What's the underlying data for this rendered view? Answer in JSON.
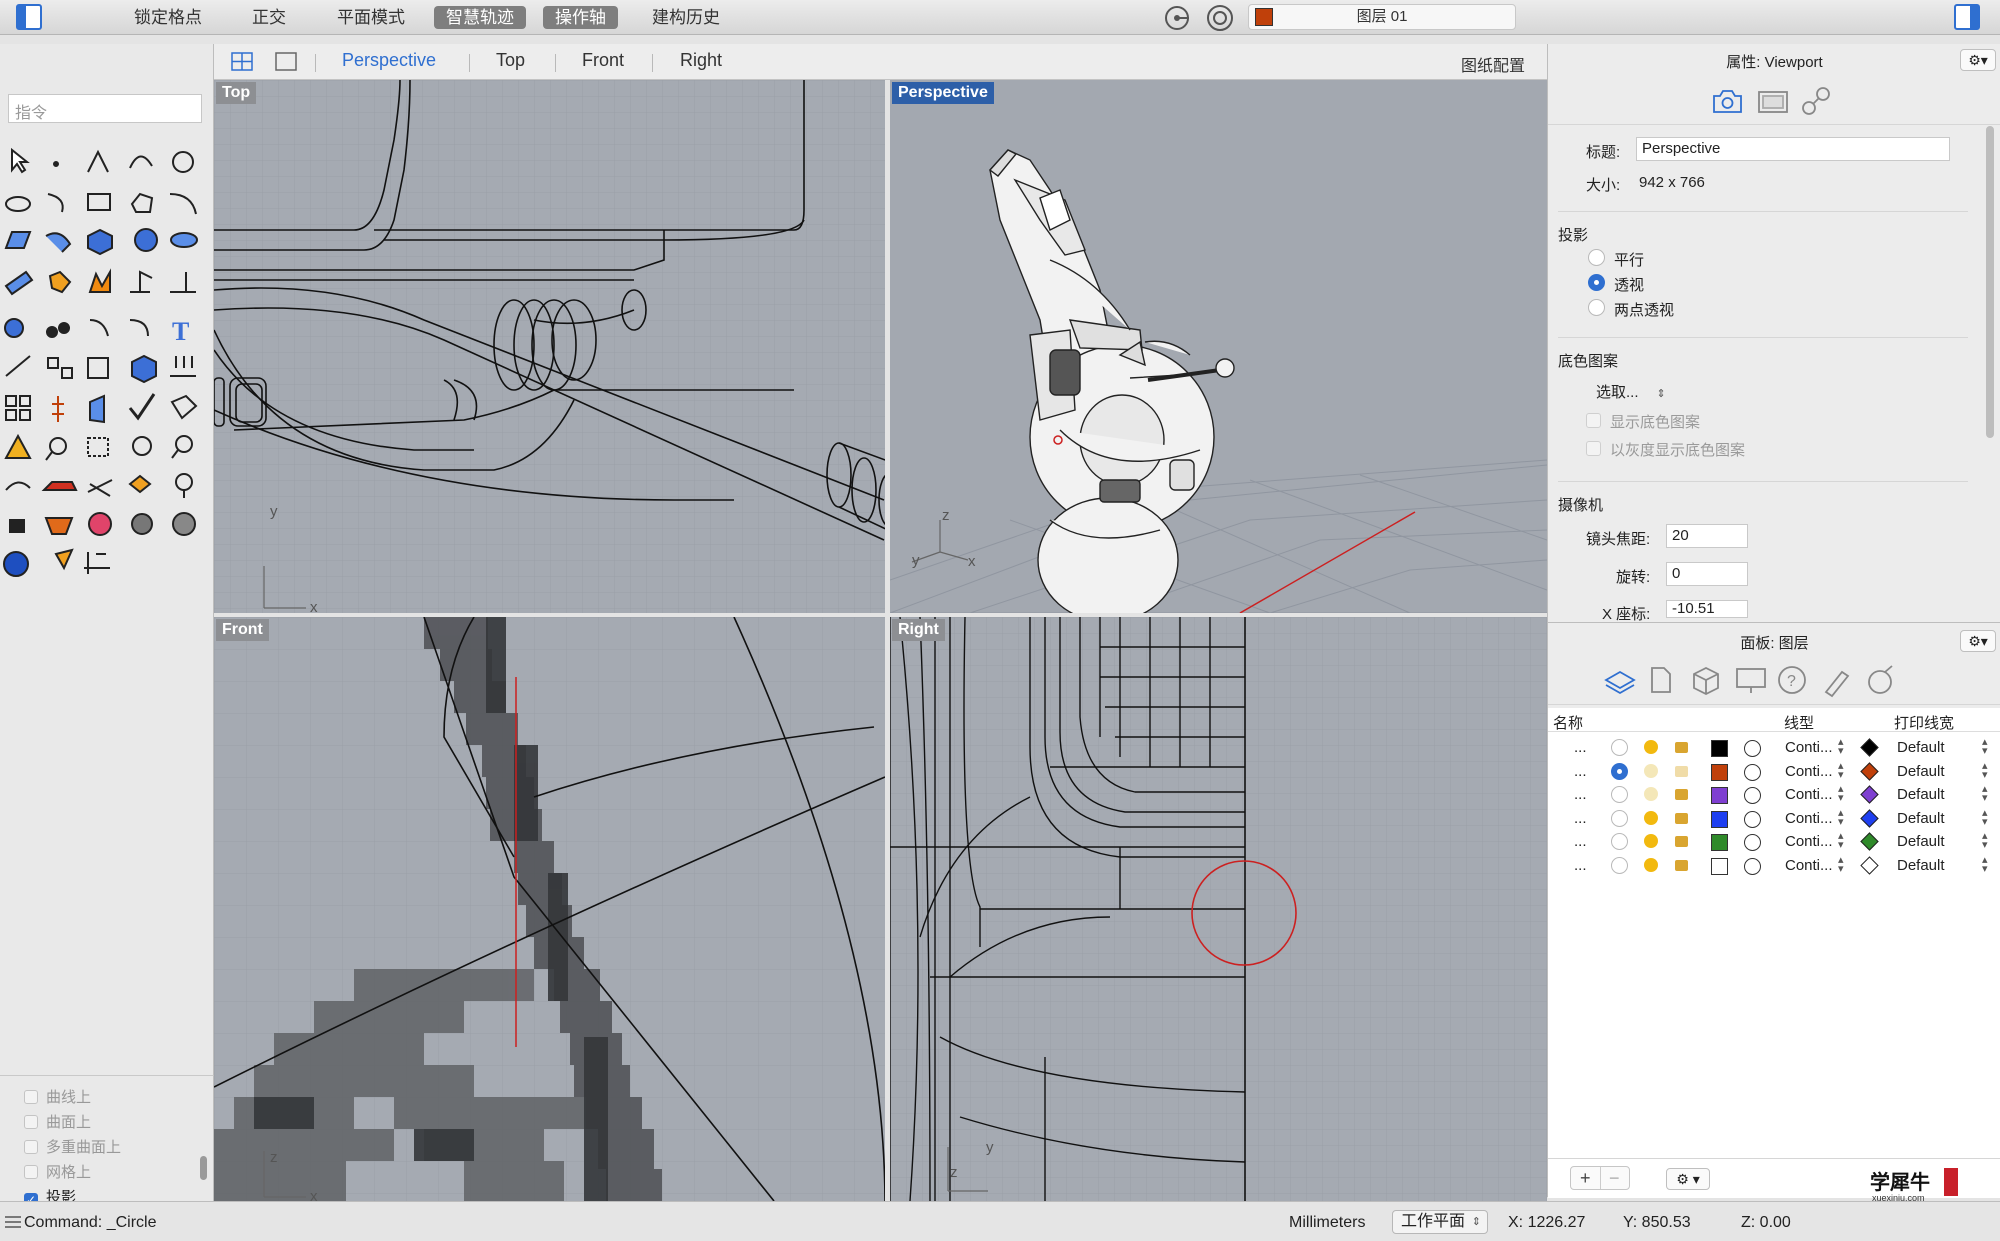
{
  "topbar": {
    "buttons": [
      "锁定格点",
      "正交",
      "平面模式",
      "智慧轨迹",
      "操作轴",
      "建构历史"
    ],
    "active": [
      3,
      4
    ],
    "layer": "图层 01",
    "layer_color": "#c0400a"
  },
  "toolbox": {
    "command_placeholder": "指令",
    "osnap": {
      "items": [
        "曲线上",
        "曲面上",
        "多重曲面上",
        "网格上",
        "投影"
      ],
      "checked": [
        false,
        false,
        false,
        false,
        true
      ]
    }
  },
  "viewport_tabs": {
    "tabs": [
      "Perspective",
      "Top",
      "Front",
      "Right"
    ],
    "active": "Perspective",
    "layout": "图纸配置"
  },
  "viewports": {
    "top": {
      "label": "Top",
      "axis_y": "y",
      "axis_x": "x"
    },
    "perspective": {
      "label": "Perspective",
      "axis_z": "z",
      "axis_y": "y",
      "axis_x": "x"
    },
    "front": {
      "label": "Front",
      "axis_z": "z",
      "axis_x": "x"
    },
    "right": {
      "label": "Right",
      "axis_z": "z",
      "axis_y": "y"
    }
  },
  "properties": {
    "title": "属性: Viewport",
    "title_label": "标题:",
    "title_value": "Perspective",
    "size_label": "大小:",
    "size_value": "942 x 766",
    "projection_heading": "投影",
    "projection_options": [
      "平行",
      "透视",
      "两点透视"
    ],
    "projection_selected": 1,
    "wallpaper_heading": "底色图案",
    "wallpaper_select": "选取...",
    "wallpaper_show": "显示底色图案",
    "wallpaper_gray": "以灰度显示底色图案",
    "camera_heading": "摄像机",
    "lens_label": "镜头焦距:",
    "lens_value": "20",
    "rotation_label": "旋转:",
    "rotation_value": "0",
    "xcoord_label": "X 座标:",
    "xcoord_value": "-10.51"
  },
  "layers_panel": {
    "title": "面板: 图层",
    "columns": [
      "名称",
      "线型",
      "打印线宽"
    ],
    "rows": [
      {
        "name": "...",
        "current": false,
        "on": true,
        "locked": true,
        "color": "#000000",
        "linetype": "Conti...",
        "printwidth": "Default"
      },
      {
        "name": "...",
        "current": true,
        "on": false,
        "locked": false,
        "color": "#c0400a",
        "linetype": "Conti...",
        "printwidth": "Default"
      },
      {
        "name": "...",
        "current": false,
        "on": false,
        "locked": true,
        "color": "#7f3fd1",
        "linetype": "Conti...",
        "printwidth": "Default"
      },
      {
        "name": "...",
        "current": false,
        "on": true,
        "locked": true,
        "color": "#1e3ff0",
        "linetype": "Conti...",
        "printwidth": "Default"
      },
      {
        "name": "...",
        "current": false,
        "on": true,
        "locked": true,
        "color": "#2f8a2a",
        "linetype": "Conti...",
        "printwidth": "Default"
      },
      {
        "name": "...",
        "current": false,
        "on": true,
        "locked": true,
        "color": "#ffffff",
        "linetype": "Conti...",
        "printwidth": "Default"
      }
    ]
  },
  "watermark": {
    "text": "学犀牛",
    "domain": "xuexiniu.com"
  },
  "status": {
    "command": "Command: _Circle",
    "units": "Millimeters",
    "cplane": "工作平面",
    "x": "X: 1226.27",
    "y": "Y: 850.53",
    "z": "Z: 0.00"
  }
}
